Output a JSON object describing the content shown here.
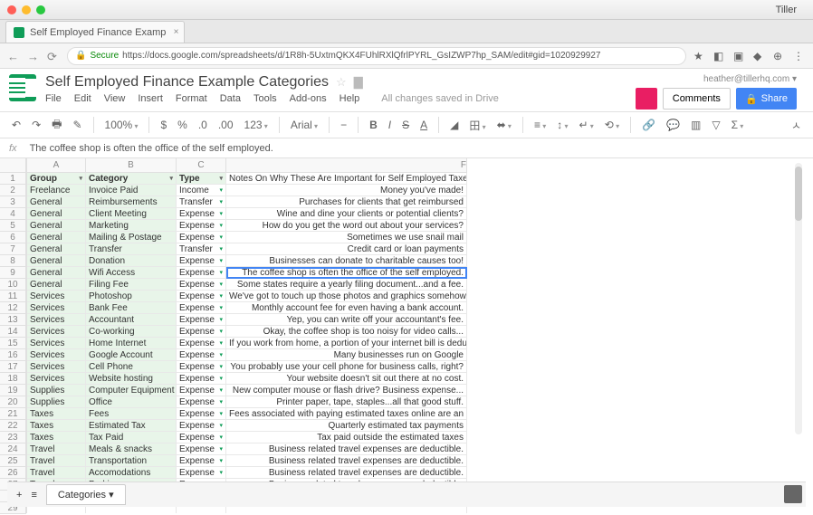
{
  "window": {
    "title": "Tiller"
  },
  "browser": {
    "tab": "Self Employed Finance Examp",
    "secure": "Secure",
    "url": "https://docs.google.com/spreadsheets/d/1R8h-5UxtmQKX4FUhlRXlQfrlPYRL_GsIZWP7hp_SAM/edit#gid=1020929927"
  },
  "doc": {
    "title": "Self Employed Finance Example Categories",
    "menus": [
      "File",
      "Edit",
      "View",
      "Insert",
      "Format",
      "Data",
      "Tools",
      "Add-ons",
      "Help"
    ],
    "saved": "All changes saved in Drive",
    "email": "heather@tillerhq.com",
    "comments": "Comments",
    "share": "Share"
  },
  "toolbar": {
    "zoom": "100%",
    "currency": "$",
    "percent": "%",
    "dec": ".0",
    "dec2": ".00",
    "fmt": "123",
    "font": "Arial"
  },
  "formula": "The coffee shop is often the office of the self employed.",
  "cols": [
    "A",
    "B",
    "C",
    "F"
  ],
  "headers": {
    "a": "Group",
    "b": "Category",
    "c": "Type",
    "f": "Notes On Why These Are Important for Self Employed Taxes"
  },
  "rows": [
    {
      "a": "Freelance",
      "b": "Invoice Paid",
      "c": "Income",
      "f": "Money you've made!"
    },
    {
      "a": "General",
      "b": "Reimbursements",
      "c": "Transfer",
      "f": "Purchases for clients that get reimbursed"
    },
    {
      "a": "General",
      "b": "Client Meeting",
      "c": "Expense",
      "f": "Wine and dine your clients or potential clients?"
    },
    {
      "a": "General",
      "b": "Marketing",
      "c": "Expense",
      "f": "How do you get the word out about your services?"
    },
    {
      "a": "General",
      "b": "Mailing & Postage",
      "c": "Expense",
      "f": "Sometimes we use snail mail"
    },
    {
      "a": "General",
      "b": "Transfer",
      "c": "Transfer",
      "f": "Credit card or loan payments"
    },
    {
      "a": "General",
      "b": "Donation",
      "c": "Expense",
      "f": "Businesses can donate to charitable causes too!"
    },
    {
      "a": "General",
      "b": "Wifi Access",
      "c": "Expense",
      "f": "The coffee shop is often the office of the self employed.",
      "active": true
    },
    {
      "a": "General",
      "b": "Filing Fee",
      "c": "Expense",
      "f": "Some states require a yearly filing document...and a fee."
    },
    {
      "a": "Services",
      "b": "Photoshop",
      "c": "Expense",
      "f": "We've got to touch up those photos and graphics somehow."
    },
    {
      "a": "Services",
      "b": "Bank Fee",
      "c": "Expense",
      "f": "Monthly account fee for even having a bank account."
    },
    {
      "a": "Services",
      "b": "Accountant",
      "c": "Expense",
      "f": "Yep, you can write off your accountant's fee."
    },
    {
      "a": "Services",
      "b": "Co-working",
      "c": "Expense",
      "f": "Okay, the coffee shop is too noisy for video calls..."
    },
    {
      "a": "Services",
      "b": "Home Internet",
      "c": "Expense",
      "f": "If you work from home, a portion of your internet bill is deductible"
    },
    {
      "a": "Services",
      "b": "Google Account",
      "c": "Expense",
      "f": "Many businesses run on Google"
    },
    {
      "a": "Services",
      "b": "Cell Phone",
      "c": "Expense",
      "f": "You probably use your cell phone for business calls, right?"
    },
    {
      "a": "Services",
      "b": "Website hosting",
      "c": "Expense",
      "f": "Your website doesn't sit out there at no cost."
    },
    {
      "a": "Supplies",
      "b": "Computer Equipment",
      "c": "Expense",
      "f": "New computer mouse or flash drive? Business expense..."
    },
    {
      "a": "Supplies",
      "b": "Office",
      "c": "Expense",
      "f": "Printer paper, tape, staples...all that good stuff."
    },
    {
      "a": "Taxes",
      "b": "Fees",
      "c": "Expense",
      "f": "Fees associated with paying estimated taxes online are an expsense"
    },
    {
      "a": "Taxes",
      "b": "Estimated Tax",
      "c": "Expense",
      "f": "Quarterly estimated tax payments"
    },
    {
      "a": "Taxes",
      "b": "Tax Paid",
      "c": "Expense",
      "f": "Tax paid outside the estimated taxes"
    },
    {
      "a": "Travel",
      "b": "Meals & snacks",
      "c": "Expense",
      "f": "Business related travel expenses are deductible."
    },
    {
      "a": "Travel",
      "b": "Transportation",
      "c": "Expense",
      "f": "Business related travel expenses are deductible."
    },
    {
      "a": "Travel",
      "b": "Accomodations",
      "c": "Expense",
      "f": "Business related travel expenses are deductible."
    },
    {
      "a": "Travel",
      "b": "Parking",
      "c": "Expense",
      "f": "Business related travel expenses are deductible."
    }
  ],
  "sheet_tab": "Categories"
}
